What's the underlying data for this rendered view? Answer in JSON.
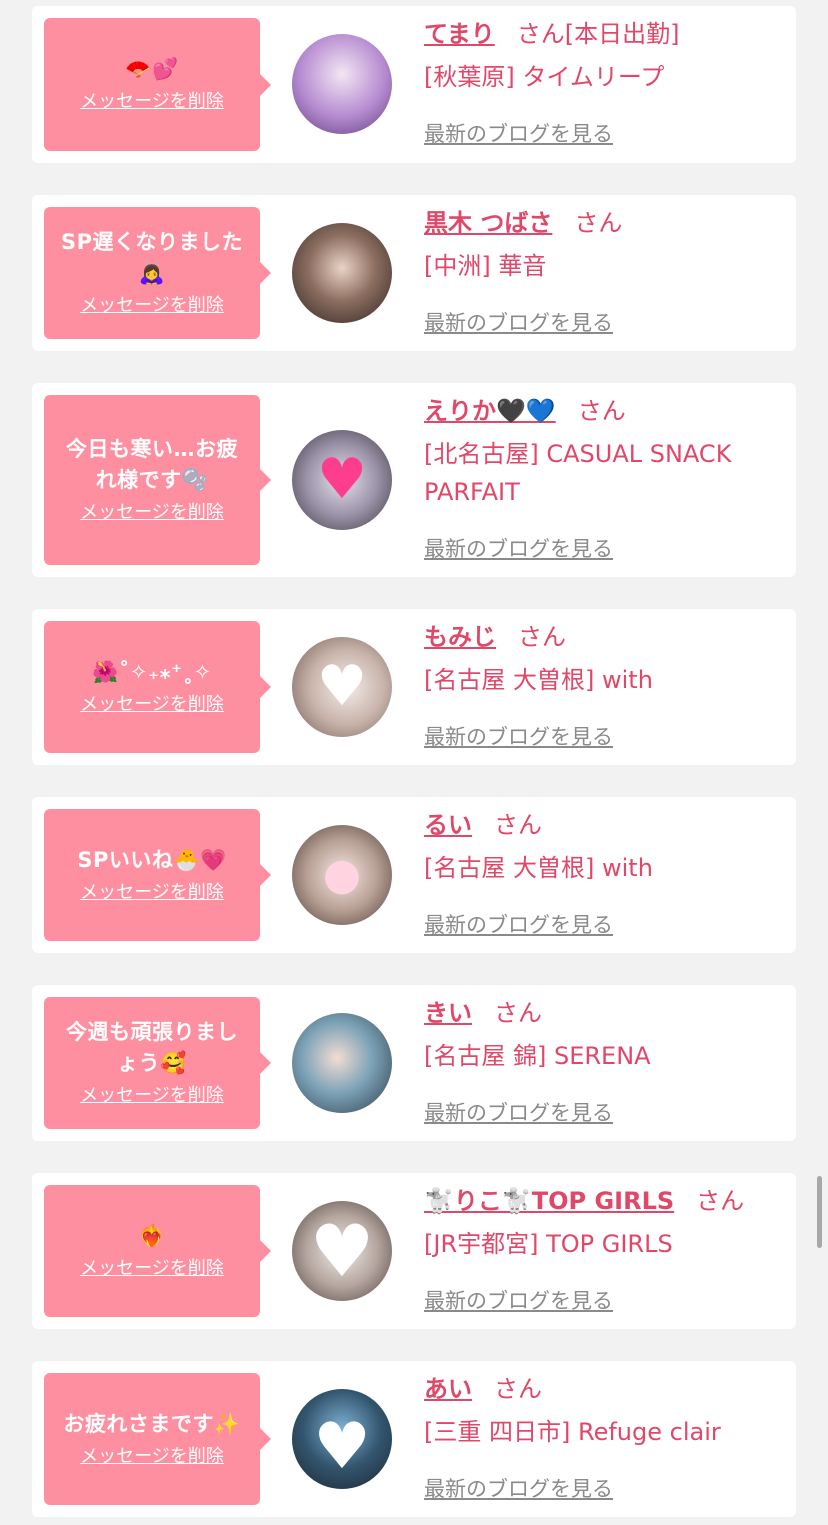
{
  "common": {
    "delete_label": "メッセージを削除",
    "blog_label": "最新のブログを見る",
    "san": "さん"
  },
  "colors": {
    "bubble": "#fe8fa0",
    "accent": "#e0486a",
    "muted": "#8a8a8a"
  },
  "items": [
    {
      "message": "🪭💕",
      "name": "てまり",
      "suffix": "さん[本日出勤]",
      "shop": "[秋葉原] タイムリープ"
    },
    {
      "message": "SP遅くなりました\n🙇‍♀️",
      "name": "黒木 つばさ",
      "suffix": "さん",
      "shop": "[中洲] 華音"
    },
    {
      "message": "今日も寒い…お疲\nれ様です🫧",
      "name": "えりか🖤💙",
      "suffix": "さん",
      "shop": "[北名古屋] CASUAL SNACK PARFAIT"
    },
    {
      "message": "🌺˚✧₊⁎⁺˳✧",
      "name": "もみじ",
      "suffix": "さん",
      "shop": "[名古屋 大曽根] with"
    },
    {
      "message": "SPいいね🐣💗",
      "name": "るい",
      "suffix": "さん",
      "shop": "[名古屋 大曽根] with"
    },
    {
      "message": "今週も頑張りまし\nょう🥰",
      "name": "きい",
      "suffix": "さん",
      "shop": "[名古屋 錦] SERENA"
    },
    {
      "message": "❤️‍🔥",
      "name": "🐩りこ🐩TOP GIRLS",
      "suffix": "さん",
      "shop": "[JR宇都宮] TOP GIRLS"
    },
    {
      "message": "お疲れさまです✨",
      "name": "あい",
      "suffix": "さん",
      "shop": "[三重 四日市] Refuge clair"
    }
  ]
}
